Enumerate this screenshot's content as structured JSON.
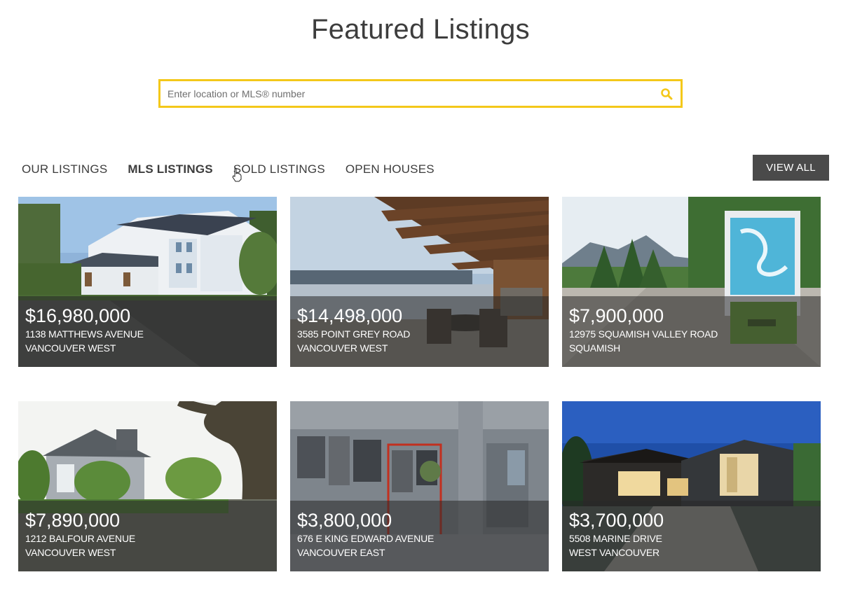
{
  "header": {
    "title": "Featured Listings"
  },
  "search": {
    "placeholder": "Enter location or MLS® number",
    "value": "",
    "icon": "search-icon"
  },
  "tabs": [
    {
      "label": "OUR LISTINGS",
      "active": false
    },
    {
      "label": "MLS LISTINGS",
      "active": true
    },
    {
      "label": "SOLD LISTINGS",
      "active": false
    },
    {
      "label": "OPEN HOUSES",
      "active": false
    }
  ],
  "view_all_label": "VIEW ALL",
  "colors": {
    "accent": "#f4c81a",
    "button": "#4a4a4a",
    "text": "#3d3d3d"
  },
  "listings": [
    {
      "price": "$16,980,000",
      "address": "1138 MATTHEWS AVENUE",
      "area": "VANCOUVER WEST"
    },
    {
      "price": "$14,498,000",
      "address": "3585 POINT GREY ROAD",
      "area": "VANCOUVER WEST"
    },
    {
      "price": "$7,900,000",
      "address": "12975 SQUAMISH VALLEY ROAD",
      "area": "SQUAMISH"
    },
    {
      "price": "$7,890,000",
      "address": "1212 BALFOUR AVENUE",
      "area": "VANCOUVER WEST"
    },
    {
      "price": "$3,800,000",
      "address": "676 E KING EDWARD AVENUE",
      "area": "VANCOUVER EAST"
    },
    {
      "price": "$3,700,000",
      "address": "5508 MARINE DRIVE",
      "area": "WEST VANCOUVER"
    }
  ]
}
